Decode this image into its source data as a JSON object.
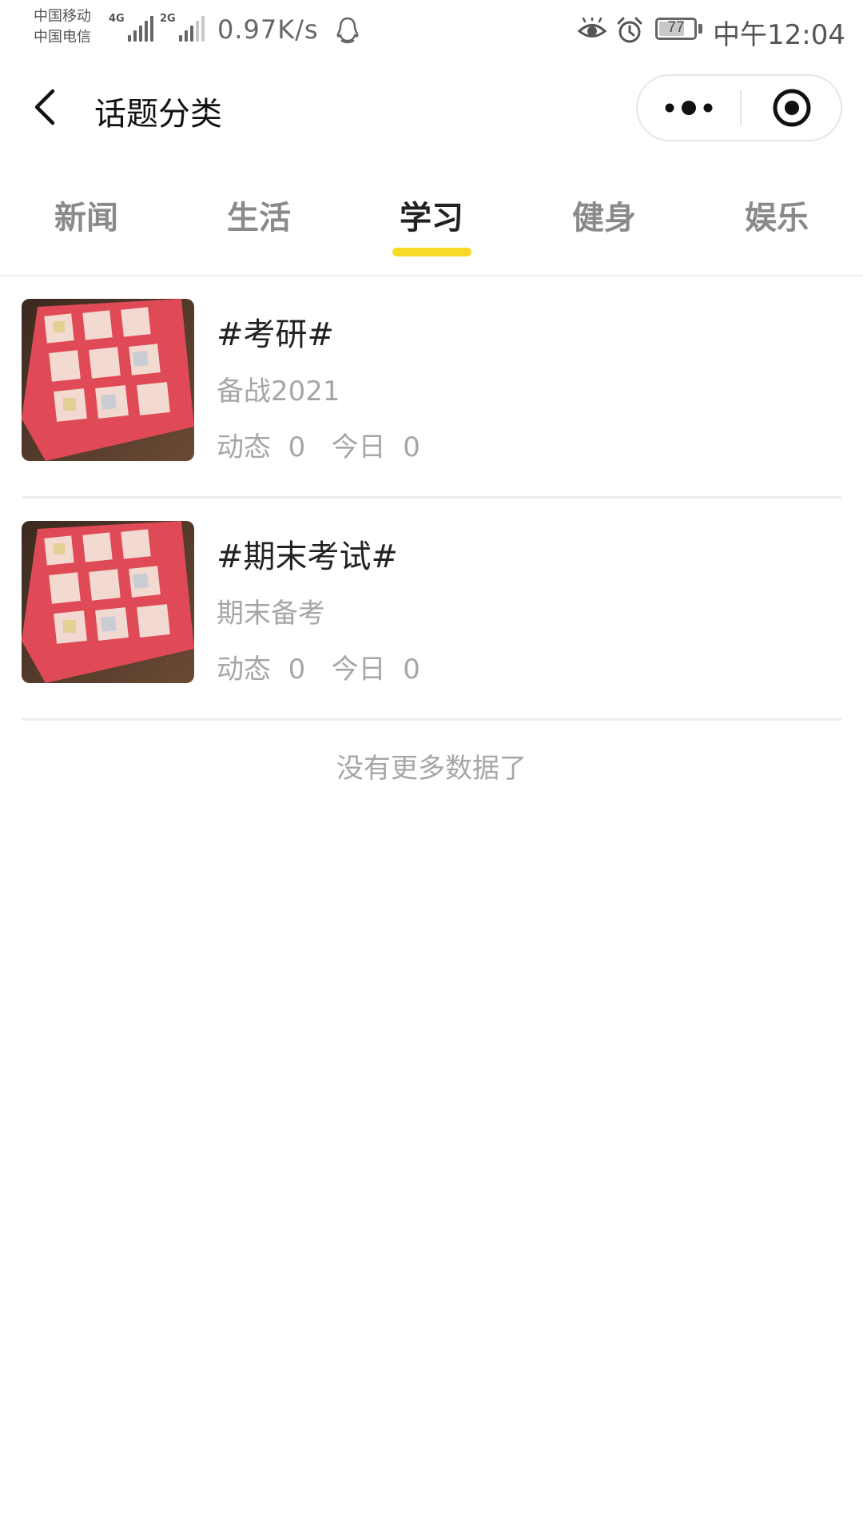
{
  "status_bar": {
    "carriers": [
      "中国移动",
      "中国电信"
    ],
    "signal_1_label": "4G",
    "signal_2_label": "2G",
    "net_speed": "0.97K/s",
    "battery_level": "77",
    "battery_percent": 77,
    "time": "中午12:04",
    "icons": [
      "qq-icon",
      "eye-icon",
      "alarm-icon",
      "battery-icon"
    ]
  },
  "nav": {
    "title": "话题分类",
    "back_icon": "chevron-left-icon",
    "more_icon": "more-dots-icon",
    "close_icon": "target-circle-icon"
  },
  "tabs": {
    "items": [
      {
        "label": "新闻"
      },
      {
        "label": "生活"
      },
      {
        "label": "学习"
      },
      {
        "label": "健身"
      },
      {
        "label": "娱乐"
      }
    ],
    "active_index": 2,
    "accent_color": "#f8d927"
  },
  "topics": [
    {
      "name": "#考研#",
      "desc": "备战2021",
      "stats": "动态  0   今日  0"
    },
    {
      "name": "#期末考试#",
      "desc": "期末备考",
      "stats": "动态  0   今日  0"
    }
  ],
  "footer": {
    "no_more_text": "没有更多数据了"
  }
}
